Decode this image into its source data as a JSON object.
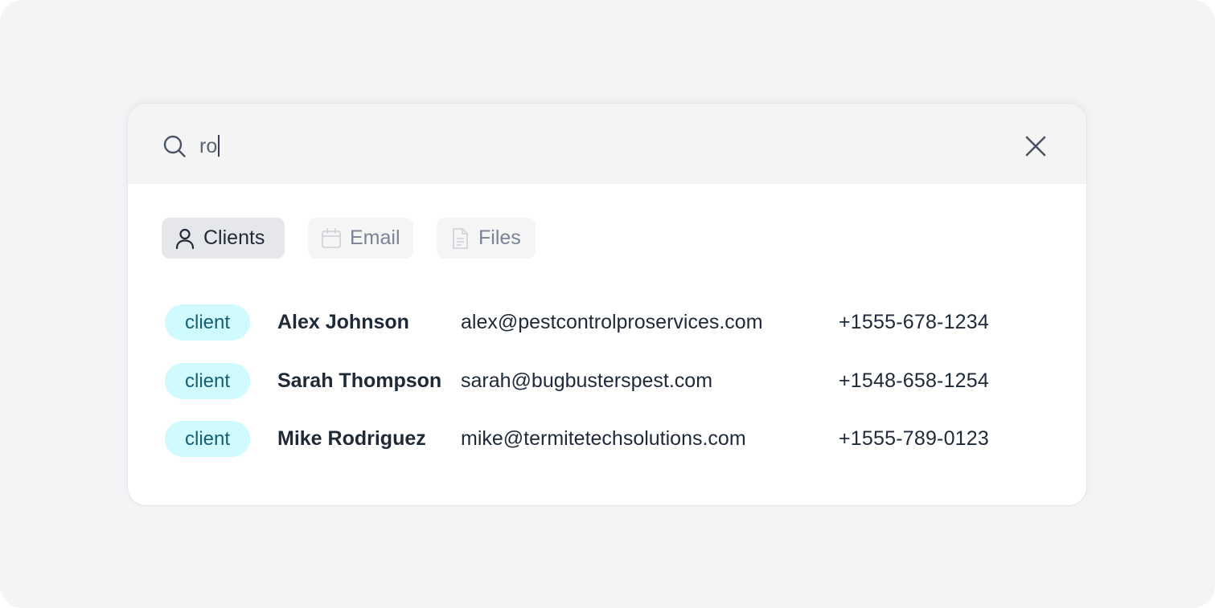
{
  "search": {
    "value": "ro",
    "icon": "search-icon",
    "close_icon": "close-icon"
  },
  "tabs": [
    {
      "label": "Clients",
      "icon": "user-icon",
      "active": true
    },
    {
      "label": "Email",
      "icon": "calendar-icon",
      "active": false
    },
    {
      "label": "Files",
      "icon": "file-icon",
      "active": false
    }
  ],
  "results": [
    {
      "type": "client",
      "name": "Alex Johnson",
      "email": "alex@pestcontrolproservices.com",
      "phone": "+1555-678-1234"
    },
    {
      "type": "client",
      "name": "Sarah Thompson",
      "email": "sarah@bugbusterspest.com",
      "phone": "+1548-658-1254"
    },
    {
      "type": "client",
      "name": "Mike Rodriguez",
      "email": "mike@termitetechsolutions.com",
      "phone": "+1555-789-0123"
    }
  ],
  "colors": {
    "badge_bg": "#cffafe",
    "badge_text": "#155e75",
    "active_tab_bg": "#e5e7eb",
    "search_bar_bg": "#f4f4f5",
    "page_bg": "#f3f4f6"
  }
}
